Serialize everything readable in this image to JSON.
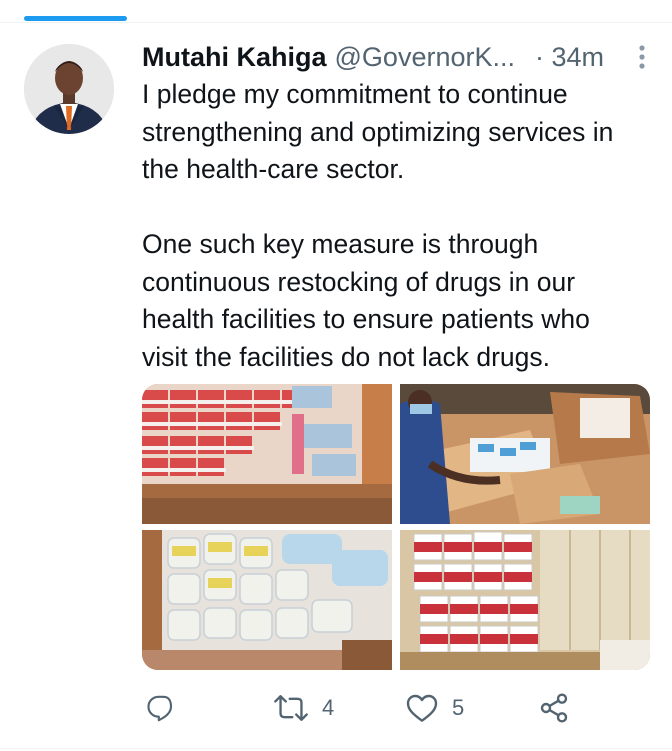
{
  "tweet": {
    "display_name": "Mutahi Kahiga",
    "handle": "@GovernorK...",
    "time": "· 34m",
    "paragraph_1_lines": [
      "I pledge my commitment to continue",
      "strengthening and optimizing services in",
      "the health-care sector."
    ],
    "paragraph_2_lines": [
      "One such key measure is through",
      "continuous restocking of drugs in our",
      "health facilities to ensure patients who",
      "visit the facilities do not lack drugs."
    ]
  },
  "actions": {
    "reply_count": "",
    "retweet_count": "4",
    "like_count": "5"
  },
  "icons": {
    "reply": "reply-icon",
    "retweet": "retweet-icon",
    "like": "heart-icon",
    "share": "share-icon",
    "more": "more-vertical-icon"
  },
  "colors": {
    "accent": "#1d9bf0",
    "text": "#0f1419",
    "secondary": "#536471"
  }
}
